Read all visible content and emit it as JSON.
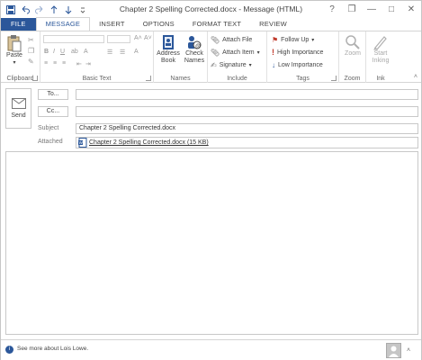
{
  "window": {
    "title": "Chapter 2 Spelling Corrected.docx - Message (HTML)",
    "controls": {
      "help": "?",
      "restore_down": "❐",
      "minimize": "—",
      "maximize": "□",
      "close": "✕"
    }
  },
  "quick_access": {
    "save_icon": "save-icon",
    "undo_icon": "undo-icon",
    "redo_icon": "redo-icon",
    "up_icon": "up-arrow-icon",
    "down_icon": "down-arrow-icon"
  },
  "tabs": [
    {
      "label": "FILE"
    },
    {
      "label": "MESSAGE"
    },
    {
      "label": "INSERT"
    },
    {
      "label": "OPTIONS"
    },
    {
      "label": "FORMAT TEXT"
    },
    {
      "label": "REVIEW"
    }
  ],
  "ribbon": {
    "clipboard": {
      "paste": "Paste",
      "label": "Clipboard"
    },
    "basic_text": {
      "label": "Basic Text"
    },
    "names": {
      "address_book": "Address Book",
      "check_names": "Check Names",
      "label": "Names"
    },
    "include": {
      "attach_file": "Attach File",
      "attach_item": "Attach Item",
      "signature": "Signature",
      "label": "Include"
    },
    "tags": {
      "follow_up": "Follow Up",
      "high_importance": "High Importance",
      "low_importance": "Low Importance",
      "label": "Tags"
    },
    "zoom": {
      "zoom": "Zoom",
      "label": "Zoom"
    },
    "ink": {
      "start_inking": "Start Inking",
      "label": "Ink"
    }
  },
  "compose": {
    "send": "Send",
    "to_button": "To...",
    "cc_button": "Cc...",
    "subject_label": "Subject",
    "subject_value": "Chapter 2 Spelling Corrected.docx",
    "attached_label": "Attached",
    "attachment": "Chapter 2 Spelling Corrected.docx (15 KB)"
  },
  "status": {
    "people_text": "See more about Lois Lowe."
  },
  "colors": {
    "accent": "#2b579a",
    "follow_up_flag": "#c0392b",
    "high_importance": "#c0392b",
    "low_importance": "#2b579a"
  }
}
